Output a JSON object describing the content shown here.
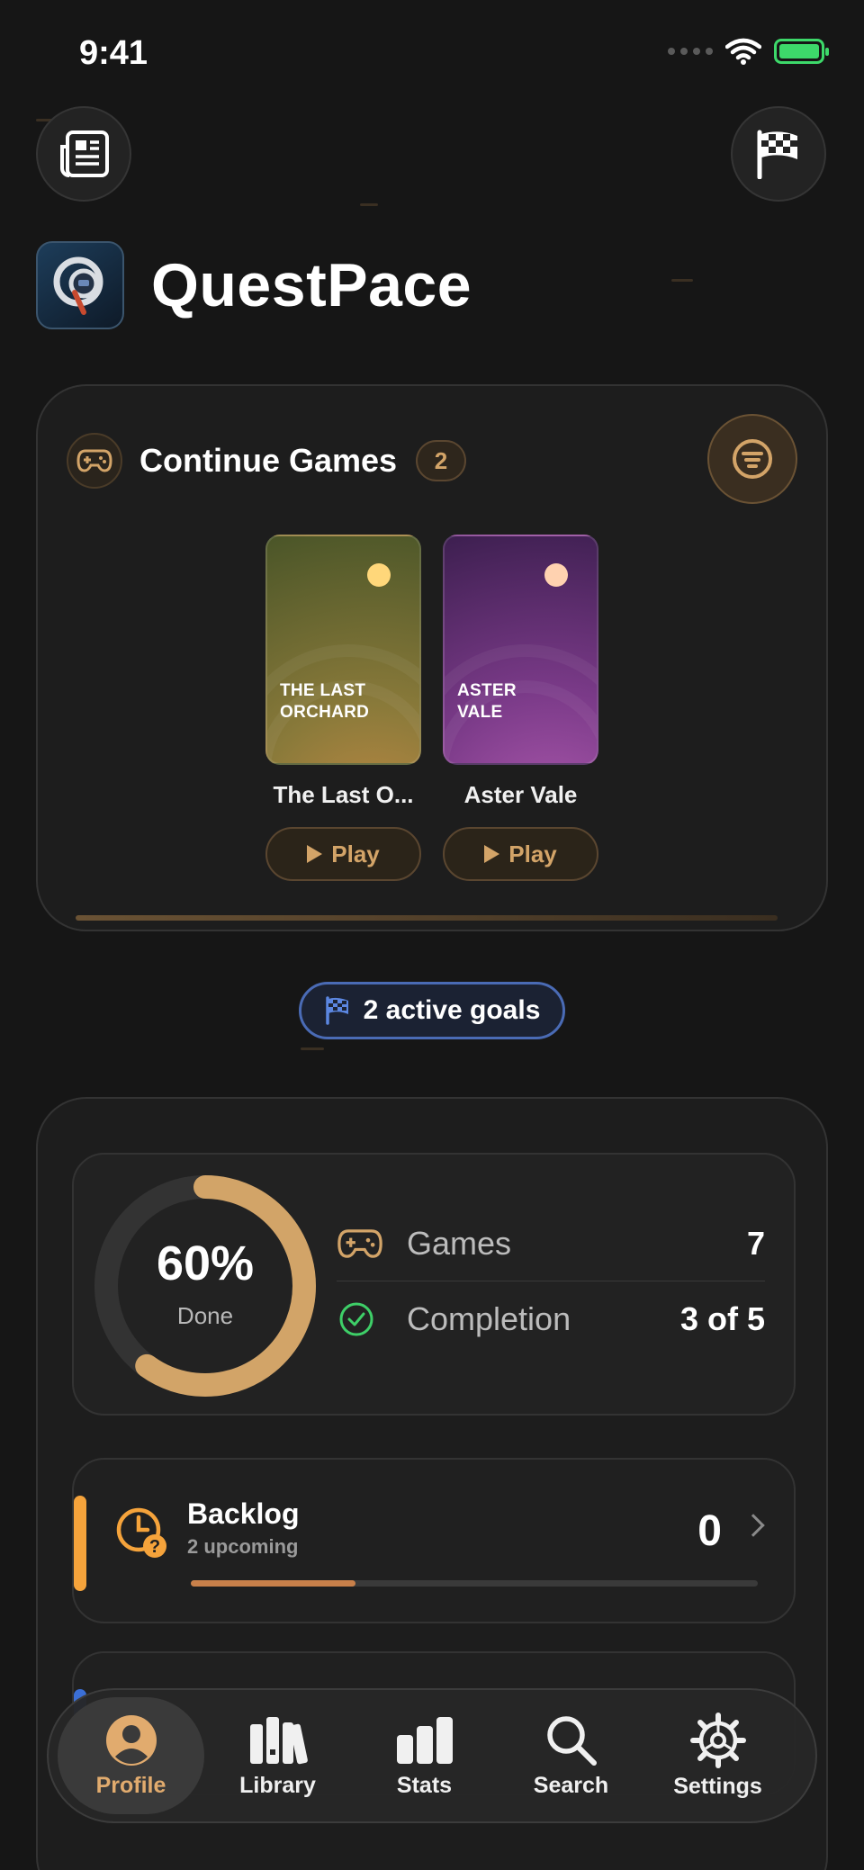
{
  "status_bar": {
    "time": "9:41"
  },
  "app": {
    "title": "QuestPace"
  },
  "continue": {
    "title": "Continue Games",
    "count": "2",
    "games": [
      {
        "cover_text": "THE LAST\nORCHARD",
        "name": "The Last O...",
        "play_label": "Play",
        "sun_color": "#ffd77a"
      },
      {
        "cover_text": "ASTER\nVALE",
        "name": "Aster Vale",
        "play_label": "Play",
        "sun_color": "#ffd2b0"
      }
    ]
  },
  "goals": {
    "label": "2 active goals"
  },
  "summary": {
    "percent": "60%",
    "percent_value": 0.6,
    "percent_label": "Done",
    "rows": [
      {
        "label": "Games",
        "value": "7",
        "icon": "gamepad-icon"
      },
      {
        "label": "Completion",
        "value": "3 of 5",
        "icon": "check-circle-icon"
      }
    ]
  },
  "backlog": {
    "title": "Backlog",
    "subtitle": "2 upcoming",
    "count": "0",
    "progress": 0.29,
    "accent": "#f5a33b"
  },
  "tabs": [
    {
      "label": "Profile",
      "icon": "person-icon",
      "active": true
    },
    {
      "label": "Library",
      "icon": "books-icon"
    },
    {
      "label": "Stats",
      "icon": "bar-chart-icon"
    },
    {
      "label": "Search",
      "icon": "search-icon"
    },
    {
      "label": "Settings",
      "icon": "gear-icon"
    }
  ],
  "colors": {
    "accent": "#d3a468",
    "goal_blue": "#4a6bb5",
    "background": "#161616"
  }
}
